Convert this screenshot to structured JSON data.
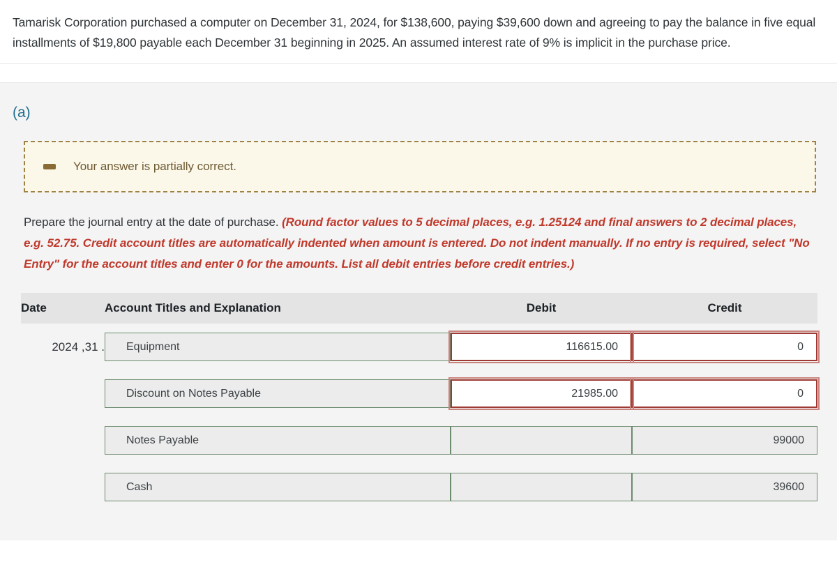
{
  "problem": {
    "text": "Tamarisk Corporation purchased a computer on December 31, 2024, for $138,600, paying $39,600 down and agreeing to pay the balance in five equal installments of $19,800 payable each December 31 beginning in 2025. An assumed interest rate of 9% is implicit in the purchase price."
  },
  "part": {
    "label": "(a)"
  },
  "alert": {
    "message": "Your answer is partially correct.",
    "icon": "partial-minus-icon",
    "border_color": "#a08245",
    "background_color": "#fcf8e9"
  },
  "instructions": {
    "normal": "Prepare the journal entry at the date of purchase.",
    "emphasis": "(Round factor values to 5 decimal places, e.g. 1.25124 and final answers to 2 decimal places, e.g. 52.75. Credit account titles are automatically indented when amount is entered. Do not indent manually. If no entry is required, select \"No Entry\" for the account titles and enter 0 for the amounts. List all debit entries before credit entries.)",
    "emphasis_color": "#c0392b"
  },
  "journal": {
    "headers": {
      "date": "Date",
      "account": "Account Titles and Explanation",
      "debit": "Debit",
      "credit": "Credit"
    },
    "rows": [
      {
        "date": ". 31, 2024",
        "account": "Equipment",
        "debit": "116615.00",
        "credit": "0",
        "debit_status": "incorrect",
        "credit_status": "incorrect"
      },
      {
        "date": "",
        "account": "Discount on Notes Payable",
        "debit": "21985.00",
        "credit": "0",
        "debit_status": "incorrect",
        "credit_status": "incorrect"
      },
      {
        "date": "",
        "account": "Notes Payable",
        "debit": "",
        "credit": "99000",
        "debit_status": "neutral",
        "credit_status": "neutral"
      },
      {
        "date": "",
        "account": "Cash",
        "debit": "",
        "credit": "39600",
        "debit_status": "neutral",
        "credit_status": "neutral"
      }
    ]
  },
  "colors": {
    "field_border_ok": "#6d8b6d",
    "field_border_error": "#9e3a33",
    "field_fill": "#ececec",
    "header_fill": "#e4e4e5",
    "section_bg": "#f4f4f5",
    "part_label": "#1f6f8b"
  }
}
